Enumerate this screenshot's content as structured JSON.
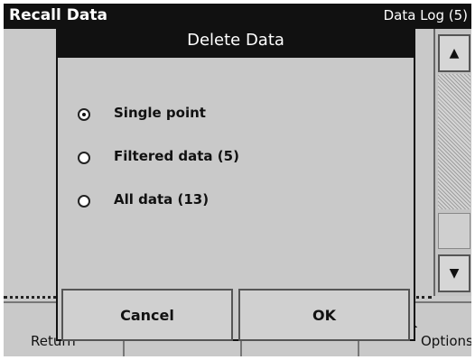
{
  "background": {
    "title_left": "Recall Data",
    "title_right": "Data Log (5)",
    "bottom_buttons": [
      "Return",
      "",
      "",
      "Options"
    ]
  },
  "dialog": {
    "title": "Delete Data",
    "options": [
      {
        "label": "Single point",
        "checked": true
      },
      {
        "label": "Filtered data (5)",
        "checked": false
      },
      {
        "label": "All data (13)",
        "checked": false
      }
    ],
    "cancel_label": "Cancel",
    "ok_label": "OK"
  },
  "icons": {
    "scroll_up": "up-arrow-icon",
    "scroll_down": "down-arrow-icon",
    "radio": "radio-icon"
  }
}
